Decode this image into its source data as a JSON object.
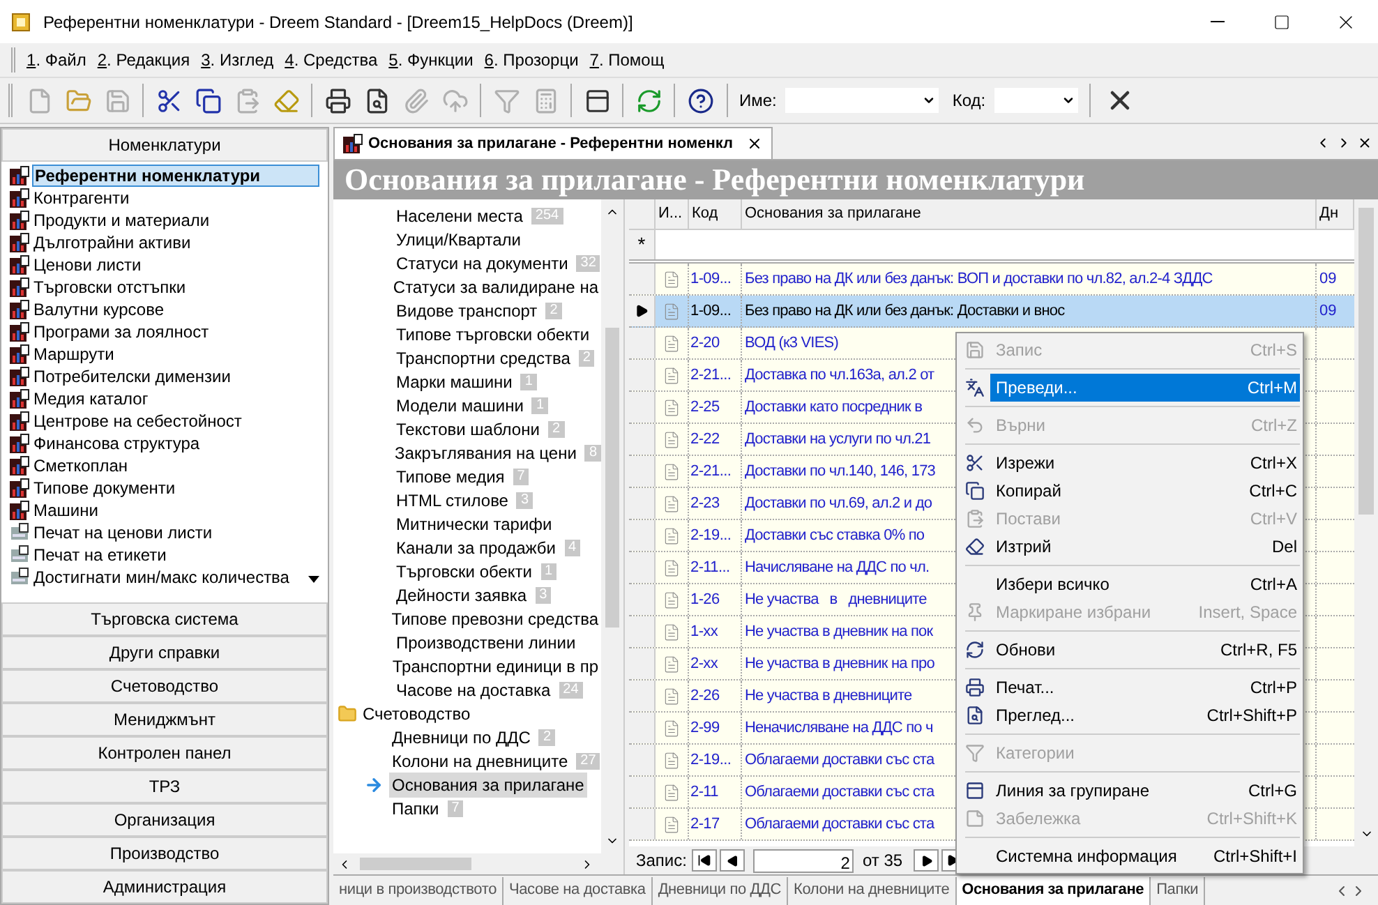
{
  "window": {
    "title": "Референтни номенклатури - Dreem Standard - [Dreem15_HelpDocs (Dreem)]"
  },
  "menu": [
    "1. Файл",
    "2. Редакция",
    "3. Изглед",
    "4. Средства",
    "5. Функции",
    "6. Прозорци",
    "7. Помощ"
  ],
  "toolbar": {
    "buttons": [
      {
        "disabled": true
      },
      {
        "disabled": false
      },
      {
        "disabled": true
      },
      {
        "disabled": false
      },
      {
        "disabled": false
      },
      {
        "disabled": true
      },
      {
        "disabled": false
      },
      {
        "disabled": false
      },
      {
        "disabled": false
      },
      {
        "disabled": true
      },
      {
        "disabled": true
      },
      {
        "disabled": true
      },
      {
        "disabled": true
      },
      {
        "disabled": false
      },
      {
        "disabled": false
      },
      {
        "disabled": false
      }
    ],
    "name_label": "Име:",
    "code_label": "Код:"
  },
  "sidebar": {
    "header": "Номенклатури",
    "items": [
      {
        "label": "Референтни номенклатури",
        "kind": "nomenclature",
        "selected": true
      },
      {
        "label": "Контрагенти",
        "kind": "nomenclature",
        "selected": false
      },
      {
        "label": "Продукти и материали",
        "kind": "nomenclature",
        "selected": false
      },
      {
        "label": "Дълготрайни активи",
        "kind": "nomenclature",
        "selected": false
      },
      {
        "label": "Ценови листи",
        "kind": "nomenclature",
        "selected": false
      },
      {
        "label": "Търговски отстъпки",
        "kind": "nomenclature",
        "selected": false
      },
      {
        "label": "Валутни курсове",
        "kind": "nomenclature",
        "selected": false
      },
      {
        "label": "Програми за лоялност",
        "kind": "nomenclature",
        "selected": false
      },
      {
        "label": "Маршрути",
        "kind": "nomenclature",
        "selected": false
      },
      {
        "label": "Потребителски димензии",
        "kind": "nomenclature",
        "selected": false
      },
      {
        "label": "Медия каталог",
        "kind": "nomenclature",
        "selected": false
      },
      {
        "label": "Центрове на себестойност",
        "kind": "nomenclature",
        "selected": false
      },
      {
        "label": "Финансова структура",
        "kind": "nomenclature",
        "selected": false
      },
      {
        "label": "Сметкоплан",
        "kind": "nomenclature",
        "selected": false
      },
      {
        "label": "Типове документи",
        "kind": "nomenclature",
        "selected": false
      },
      {
        "label": "Машини",
        "kind": "nomenclature",
        "selected": false
      },
      {
        "label": "Печат на ценови листи",
        "kind": "report",
        "selected": false
      },
      {
        "label": "Печат на етикети",
        "kind": "report",
        "selected": false
      },
      {
        "label": "Достигнати мин/макс количества",
        "kind": "report",
        "selected": false
      }
    ],
    "groups": [
      "Търговска система",
      "Други справки",
      "Счетоводство",
      "Мениджмънт",
      "Контролен панел",
      "ТРЗ",
      "Организация",
      "Производство",
      "Администрация"
    ]
  },
  "document_tab": {
    "title": "Основания за прилагане - Референтни номенкл"
  },
  "banner": "Основания за прилагане - Референтни номенклатури",
  "tree": {
    "continued_children": [
      {
        "label": "Населени места",
        "count": "254",
        "selected": false
      },
      {
        "label": "Улици/Квартали",
        "selected": false
      },
      {
        "label": "Статуси на документи",
        "count": "32",
        "selected": false
      },
      {
        "label": "Статуси за валидиране на",
        "selected": false
      },
      {
        "label": "Видове транспорт",
        "count": "2",
        "selected": false
      },
      {
        "label": "Типове търговски обекти",
        "selected": false
      },
      {
        "label": "Транспортни средства",
        "count": "2",
        "selected": false
      },
      {
        "label": "Марки машини",
        "count": "1",
        "selected": false
      },
      {
        "label": "Модели машини",
        "count": "1",
        "selected": false
      },
      {
        "label": "Текстови шаблони",
        "count": "2",
        "selected": false
      },
      {
        "label": "Закръглявания на цени",
        "count": "8",
        "selected": false
      },
      {
        "label": "Типове медия",
        "count": "7",
        "selected": false
      },
      {
        "label": "HTML стилове",
        "count": "3",
        "selected": false
      },
      {
        "label": "Митнически тарифи",
        "selected": false
      },
      {
        "label": "Канали за продажби",
        "count": "4",
        "selected": false
      },
      {
        "label": "Търговски обекти",
        "count": "1",
        "selected": false
      },
      {
        "label": "Дейности заявка",
        "count": "3",
        "selected": false
      },
      {
        "label": "Типове превозни средства",
        "selected": false
      },
      {
        "label": "Производствени линии",
        "selected": false
      },
      {
        "label": "Транспортни единици в пр",
        "selected": false
      },
      {
        "label": "Часове на доставка",
        "count": "24",
        "selected": false
      }
    ],
    "nodes": [
      {
        "label": "Счетоводство",
        "expanded": true,
        "children": [
          {
            "label": "Дневници по ДДС",
            "count": "2",
            "selected": false
          },
          {
            "label": "Колони на дневниците",
            "count": "27",
            "selected": false
          },
          {
            "label": "Основания за прилагане",
            "selected": true
          },
          {
            "label": "Папки",
            "count": "7",
            "selected": false
          }
        ]
      }
    ]
  },
  "table": {
    "columns": [
      "И...",
      "Код",
      "Основания за прилагане",
      "Дн"
    ],
    "new_row_marker": "*",
    "rows": [
      {
        "code": "1-09...",
        "name": "Без право на ДК или без данък: ВОП и доставки по чл.82, ал.2-4 ЗДДС",
        "journal": "09",
        "selected": false
      },
      {
        "code": "1-09...",
        "name": "Без право на ДК или без данък: Доставки и внос",
        "journal": "09",
        "selected": true
      },
      {
        "code": "2-20",
        "name": "ВОД (к3 VIES)",
        "selected": false
      },
      {
        "code": "2-21...",
        "name": "Доставка по чл.163а, ал.2 от",
        "selected": false
      },
      {
        "code": "2-25",
        "name": "Доставки като посредник в",
        "selected": false
      },
      {
        "code": "2-22",
        "name": "Доставки на услуги по чл.21",
        "selected": false
      },
      {
        "code": "2-21...",
        "name": "Доставки по чл.140, 146, 173",
        "selected": false
      },
      {
        "code": "2-23",
        "name": "Доставки по чл.69, ал.2 и до",
        "selected": false
      },
      {
        "code": "2-19...",
        "name": "Доставки със ставка 0% по",
        "selected": false
      },
      {
        "code": "2-11...",
        "name": "Начисляване на ДДС по чл.",
        "selected": false
      },
      {
        "code": "1-26",
        "name": "Не участва   в   дневниците",
        "selected": false
      },
      {
        "code": "1-xx",
        "name": "Не участва в дневник на пок",
        "selected": false
      },
      {
        "code": "2-xx",
        "name": "Не участва в дневник на про",
        "selected": false
      },
      {
        "code": "2-26",
        "name": "Не участва в дневниците",
        "selected": false
      },
      {
        "code": "2-99",
        "name": "Неначисляване на ДДС по ч",
        "selected": false
      },
      {
        "code": "2-19...",
        "name": "Облагаеми доставки със ста",
        "selected": false
      },
      {
        "code": "2-11",
        "name": "Облагаеми доставки със ста",
        "selected": false
      },
      {
        "code": "2-17",
        "name": "Облагаеми доставки със ста",
        "selected": false
      }
    ],
    "navigator": {
      "label": "Запис:",
      "current": "2",
      "total": "от 35"
    }
  },
  "context_menu": [
    {
      "kind": "item",
      "label": "Запис",
      "shortcut": "Ctrl+S",
      "disabled": true,
      "selected": false
    },
    {
      "kind": "separator"
    },
    {
      "kind": "item",
      "label": "Преведи...",
      "shortcut": "Ctrl+M",
      "disabled": false,
      "selected": true
    },
    {
      "kind": "separator"
    },
    {
      "kind": "item",
      "label": "Върни",
      "shortcut": "Ctrl+Z",
      "disabled": true,
      "selected": false
    },
    {
      "kind": "separator"
    },
    {
      "kind": "item",
      "label": "Изрежи",
      "shortcut": "Ctrl+X",
      "disabled": false,
      "selected": false
    },
    {
      "kind": "item",
      "label": "Копирай",
      "shortcut": "Ctrl+C",
      "disabled": false,
      "selected": false
    },
    {
      "kind": "item",
      "label": "Постави",
      "shortcut": "Ctrl+V",
      "disabled": true,
      "selected": false
    },
    {
      "kind": "item",
      "label": "Изтрий",
      "shortcut": "Del",
      "disabled": false,
      "selected": false
    },
    {
      "kind": "separator"
    },
    {
      "kind": "item",
      "label": "Избери всичко",
      "shortcut": "Ctrl+A",
      "disabled": false,
      "selected": false
    },
    {
      "kind": "item",
      "label": "Маркиране избрани",
      "shortcut": "Insert, Space",
      "disabled": true,
      "selected": false
    },
    {
      "kind": "separator"
    },
    {
      "kind": "item",
      "label": "Обнови",
      "shortcut": "Ctrl+R, F5",
      "disabled": false,
      "selected": false
    },
    {
      "kind": "separator"
    },
    {
      "kind": "item",
      "label": "Печат...",
      "shortcut": "Ctrl+P",
      "disabled": false,
      "selected": false
    },
    {
      "kind": "item",
      "label": "Преглед...",
      "shortcut": "Ctrl+Shift+P",
      "disabled": false,
      "selected": false
    },
    {
      "kind": "separator"
    },
    {
      "kind": "item",
      "label": "Категории",
      "disabled": true,
      "selected": false
    },
    {
      "kind": "separator"
    },
    {
      "kind": "item",
      "label": "Линия за групиране",
      "shortcut": "Ctrl+G",
      "disabled": false,
      "selected": false
    },
    {
      "kind": "item",
      "label": "Забележка",
      "shortcut": "Ctrl+Shift+K",
      "disabled": true,
      "selected": false
    },
    {
      "kind": "separator"
    },
    {
      "kind": "item",
      "label": "Системна информация",
      "shortcut": "Ctrl+Shift+I",
      "disabled": false,
      "selected": false
    }
  ],
  "bottom_tabs": [
    {
      "label": "ници в производството",
      "selected": false
    },
    {
      "label": "Часове на доставка",
      "selected": false
    },
    {
      "label": "Дневници по ДДС",
      "selected": false
    },
    {
      "label": "Колони на дневниците",
      "selected": false
    },
    {
      "label": "Основания за прилагане",
      "selected": true
    },
    {
      "label": "Папки",
      "selected": false
    }
  ]
}
